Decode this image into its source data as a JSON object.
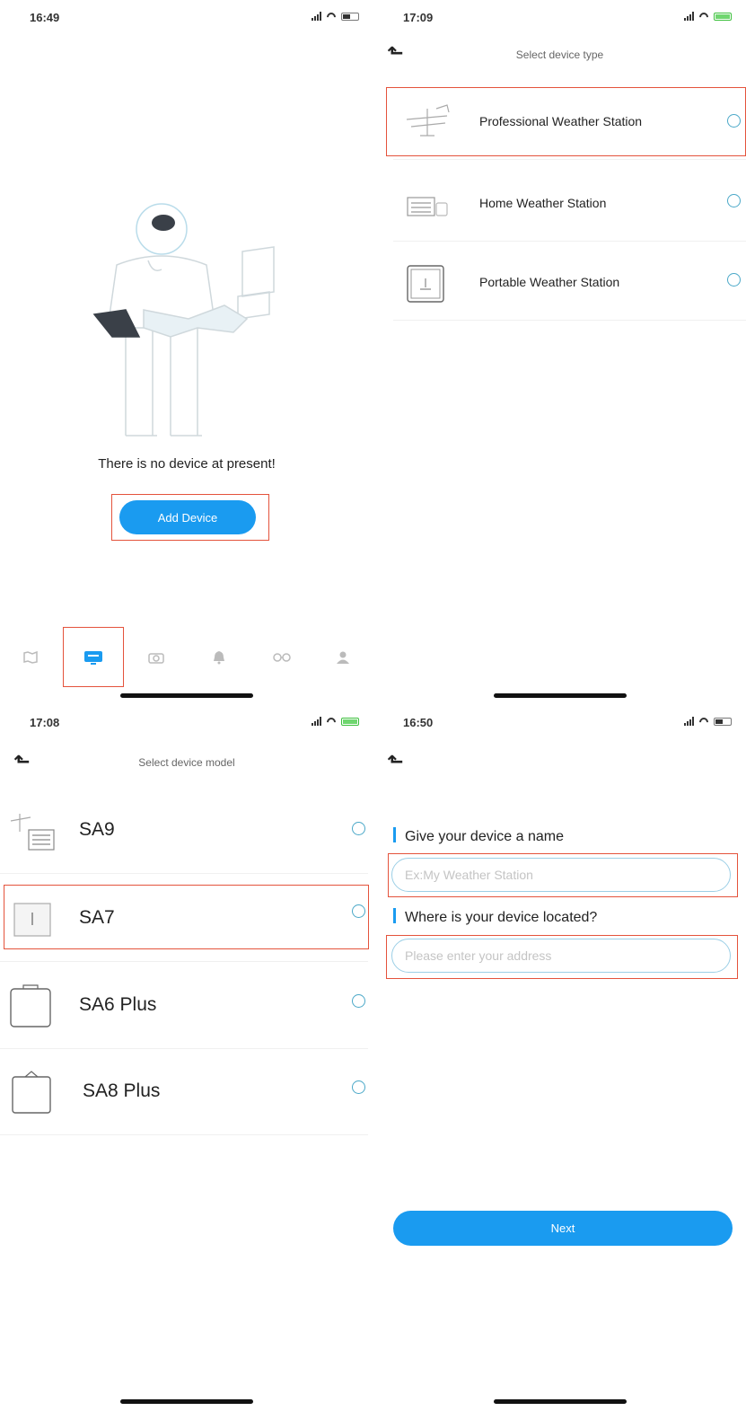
{
  "screen1": {
    "time": "16:49",
    "empty_message": "There is no device at present!",
    "add_button": "Add Device",
    "tabs": [
      "map-icon",
      "device-icon",
      "camera-icon",
      "bell-icon",
      "glasses-icon",
      "user-icon"
    ],
    "active_tab": "device-icon"
  },
  "screen2": {
    "time": "17:09",
    "title": "Select device type",
    "types": [
      {
        "label": "Professional Weather Station",
        "icon": "pro-station-icon"
      },
      {
        "label": "Home Weather Station",
        "icon": "home-station-icon"
      },
      {
        "label": "Portable Weather Station",
        "icon": "portable-station-icon"
      }
    ]
  },
  "screen3": {
    "time": "17:08",
    "title": "Select device model",
    "models": [
      {
        "label": "SA9",
        "icon": "sa9-icon"
      },
      {
        "label": "SA7",
        "icon": "sa7-icon"
      },
      {
        "label": "SA6 Plus",
        "icon": "sa6-plus-icon"
      },
      {
        "label": "SA8 Plus",
        "icon": "sa8-plus-icon"
      }
    ]
  },
  "screen4": {
    "time": "16:50",
    "name_label": "Give your device a name",
    "name_placeholder": "Ex:My Weather Station",
    "location_label": "Where is your device located?",
    "location_placeholder": "Please enter your address",
    "next_button": "Next"
  },
  "colors": {
    "accent": "#1a9bf0",
    "highlight_box": "#e4533c",
    "radio": "#4aa8c8",
    "battery_charging": "#6fd66f"
  }
}
